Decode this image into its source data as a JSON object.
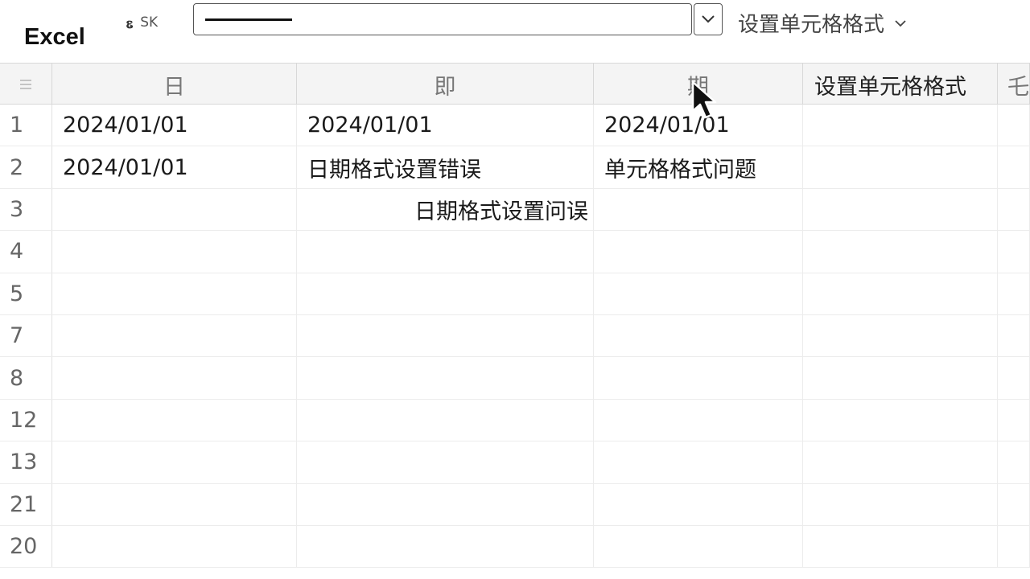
{
  "app": {
    "title": "Excel"
  },
  "toolbar": {
    "cellref_icon": "ꮛ",
    "cellref_text": "SK",
    "format_menu_label": "设置单元格格式",
    "chevron": "⌄"
  },
  "columns": [
    {
      "label": "日"
    },
    {
      "label": "即"
    },
    {
      "label": "期"
    },
    {
      "label": "设置单元格格式"
    },
    {
      "label": "乇"
    }
  ],
  "rows": [
    {
      "num": "1",
      "cells": [
        "2024/01/01",
        "2024/01/01",
        "2024/01/01",
        "",
        ""
      ]
    },
    {
      "num": "2",
      "cells": [
        "2024/01/01",
        "日期格式设置错误",
        "单元格格式问题",
        "",
        ""
      ]
    },
    {
      "num": "3",
      "cells": [
        "",
        "日期格式设置问误",
        "",
        "",
        ""
      ]
    },
    {
      "num": "4",
      "cells": [
        "",
        "",
        "",
        "",
        ""
      ]
    },
    {
      "num": "5",
      "cells": [
        "",
        "",
        "",
        "",
        ""
      ]
    },
    {
      "num": "7",
      "cells": [
        "",
        "",
        "",
        "",
        ""
      ]
    },
    {
      "num": "8",
      "cells": [
        "",
        "",
        "",
        "",
        ""
      ]
    },
    {
      "num": "12",
      "cells": [
        "",
        "",
        "",
        "",
        ""
      ]
    },
    {
      "num": "13",
      "cells": [
        "",
        "",
        "",
        "",
        ""
      ]
    },
    {
      "num": "21",
      "cells": [
        "",
        "",
        "",
        "",
        ""
      ]
    },
    {
      "num": "20",
      "cells": [
        "",
        "",
        "",
        "",
        ""
      ]
    }
  ]
}
